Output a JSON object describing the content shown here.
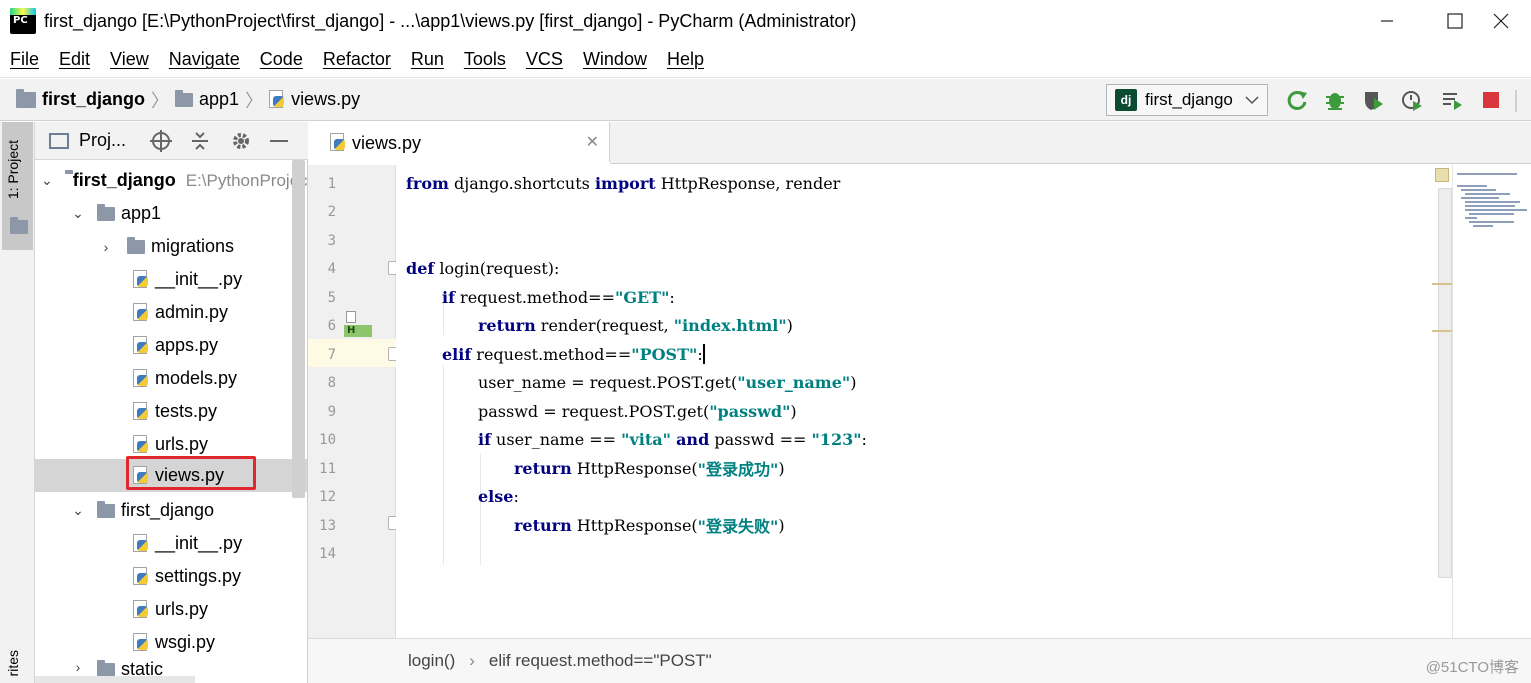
{
  "window": {
    "title": "first_django [E:\\PythonProject\\first_django] - ...\\app1\\views.py [first_django] - PyCharm (Administrator)"
  },
  "menu": [
    "File",
    "Edit",
    "View",
    "Navigate",
    "Code",
    "Refactor",
    "Run",
    "Tools",
    "VCS",
    "Window",
    "Help"
  ],
  "breadcrumb": {
    "project": "first_django",
    "folder": "app1",
    "file": "views.py"
  },
  "run_config": {
    "label": "first_django",
    "icon_text": "dj"
  },
  "left_strip": {
    "project_tab": "1: Project",
    "favorites_tab": "rites"
  },
  "project_panel": {
    "header_label": "Proj...",
    "root": {
      "name": "first_django",
      "path": "E:\\PythonProject\\first_django"
    },
    "app1_folder": "app1",
    "app1_items": [
      "migrations",
      "__init__.py",
      "admin.py",
      "apps.py",
      "models.py",
      "tests.py",
      "urls.py",
      "views.py"
    ],
    "pkg_folder": "first_django",
    "pkg_items": [
      "__init__.py",
      "settings.py",
      "urls.py",
      "wsgi.py"
    ],
    "next_folder": "static"
  },
  "tab": {
    "label": "views.py"
  },
  "line_numbers": [
    "1",
    "2",
    "3",
    "4",
    "5",
    "6",
    "7",
    "8",
    "9",
    "10",
    "11",
    "12",
    "13",
    "14"
  ],
  "code": {
    "l1_kw1": "from",
    "l1_t1": " django.shortcuts ",
    "l1_kw2": "import",
    "l1_t2": " HttpResponse, render",
    "l4_kw": "def",
    "l4_t": " login(request):",
    "l5_kw": "if",
    "l5_t": " request.method==",
    "l5_s": "\"GET\"",
    "l5_e": ":",
    "l6_kw": "return",
    "l6_t": " render(request, ",
    "l6_s": "\"index.html\"",
    "l6_e": ")",
    "l7_kw": "elif",
    "l7_t": " request.method==",
    "l7_s": "\"POST\"",
    "l7_e": ":",
    "l8_t": "user_name = request.POST.get(",
    "l8_s": "\"user_name\"",
    "l8_e": ")",
    "l9_t": "passwd = request.POST.get(",
    "l9_s": "\"passwd\"",
    "l9_e": ")",
    "l10_kw": "if",
    "l10_t": " user_name == ",
    "l10_s": "\"vita\"",
    "l10_kw2": "and",
    "l10_t2": " passwd == ",
    "l10_s2": "\"123\"",
    "l10_e": ":",
    "l11_kw": "return",
    "l11_t": " HttpResponse(",
    "l11_s": "\"登录成功\"",
    "l11_e": ")",
    "l12_kw": "else",
    "l12_e": ":",
    "l13_kw": "return",
    "l13_t": " HttpResponse(",
    "l13_s": "\"登录失败\"",
    "l13_e": ")"
  },
  "gutter_marker": "H",
  "status": {
    "crumb1": "login()",
    "sep": "›",
    "crumb2": "elif request.method==\"POST\""
  },
  "watermark": "@51CTO博客"
}
